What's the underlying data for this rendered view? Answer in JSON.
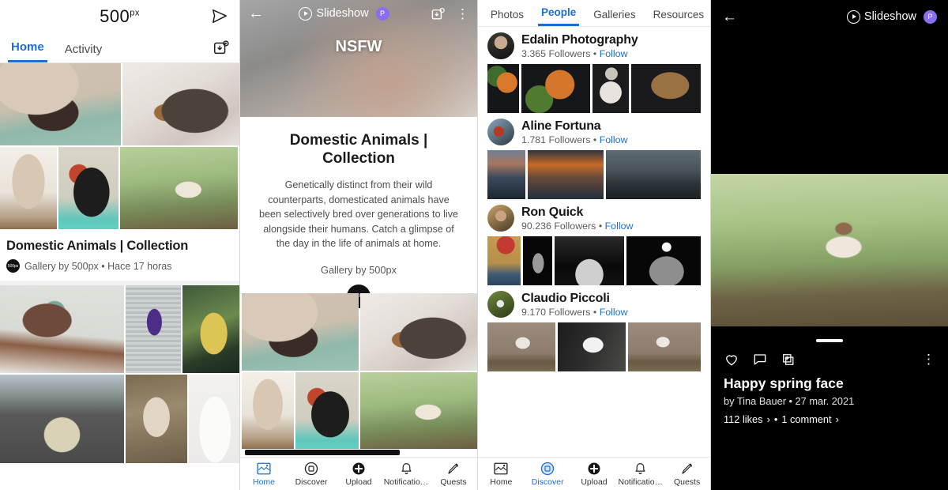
{
  "panel1": {
    "brand": "500",
    "brand_sup": "px",
    "icons": {
      "send": "send-icon",
      "save": "save-collection-icon"
    },
    "tabs": [
      {
        "label": "Home",
        "active": true
      },
      {
        "label": "Activity",
        "active": false
      }
    ],
    "card": {
      "title": "Domestic Animals | Collection",
      "byline": "Gallery by 500px • Hace 17 horas",
      "avatar_text": "500px"
    },
    "grid_top": [
      {
        "name": "cat-on-shoulder"
      },
      {
        "name": "dogs-on-bed"
      },
      {
        "name": "borzoi-dog"
      },
      {
        "name": "black-schnauzer"
      },
      {
        "name": "running-dog-forest"
      }
    ],
    "grid_bottom": [
      {
        "name": "woman-at-table"
      },
      {
        "name": "man-purple-jacket"
      },
      {
        "name": "woman-yellow-leaves"
      },
      {
        "name": "tent-on-road"
      },
      {
        "name": "portrait-woman-branches"
      },
      {
        "name": "white-pomeranian"
      }
    ]
  },
  "panel2": {
    "back": "←",
    "slideshow_label": "Slideshow",
    "badge": "P",
    "hero_title": "NSFW",
    "title": "Domestic Animals | Collection",
    "description": "Genetically distinct from their wild counterparts, domesticated animals have been selectively bred over generations to live alongside their humans. Catch a glimpse of the day in the life of animals at home.",
    "gallery_by": "Gallery by 500px",
    "logo_text": "500px",
    "nav": [
      {
        "label": "Home",
        "icon": "home-icon",
        "active": true
      },
      {
        "label": "Discover",
        "icon": "discover-icon",
        "active": false
      },
      {
        "label": "Upload",
        "icon": "upload-icon",
        "active": false
      },
      {
        "label": "Notificatio…",
        "icon": "bell-icon",
        "active": false
      },
      {
        "label": "Quests",
        "icon": "quests-icon",
        "active": false
      }
    ]
  },
  "panel3": {
    "tabs": [
      {
        "label": "Photos",
        "active": false
      },
      {
        "label": "People",
        "active": true
      },
      {
        "label": "Galleries",
        "active": false
      },
      {
        "label": "Resources",
        "active": false
      }
    ],
    "users": [
      {
        "name": "Edalin Photography",
        "followers": "3.365 Followers",
        "dot": "•",
        "follow": "Follow",
        "thumbs": [
          "soup-bowls-dark",
          "pumpkin-soup",
          "berry-bowl",
          "walnut-crate"
        ]
      },
      {
        "name": "Aline Fortuna",
        "followers": "1.781 Followers",
        "dot": "•",
        "follow": "Follow",
        "thumbs": [
          "coastal-dusk",
          "sunset-mountain",
          "moody-mountain"
        ]
      },
      {
        "name": "Ron Quick",
        "followers": "90.236 Followers",
        "dot": "•",
        "follow": "Follow",
        "thumbs": [
          "red-lamp-interior",
          "bw-vase",
          "bw-stage-piano",
          "bw-streetlamp"
        ]
      },
      {
        "name": "Claudio Piccoli",
        "followers": "9.170 Followers",
        "dot": "•",
        "follow": "Follow",
        "thumbs": [
          "border-collie-1",
          "border-collie-bw",
          "border-collie-2"
        ]
      }
    ],
    "nav": [
      {
        "label": "Home",
        "icon": "home-icon",
        "active": false
      },
      {
        "label": "Discover",
        "icon": "discover-icon",
        "active": true
      },
      {
        "label": "Upload",
        "icon": "upload-icon",
        "active": false
      },
      {
        "label": "Notificatio…",
        "icon": "bell-icon",
        "active": false
      },
      {
        "label": "Quests",
        "icon": "quests-icon",
        "active": false
      }
    ]
  },
  "panel4": {
    "back": "←",
    "slideshow_label": "Slideshow",
    "badge": "P",
    "photo": "running-dog-forest",
    "title": "Happy spring face",
    "byline": "by Tina Bauer  •  27 mar. 2021",
    "likes": "112 likes",
    "chev1": "›",
    "dot": "•",
    "comments": "1 comment",
    "chev2": "›",
    "kebab": "⋮",
    "actions": [
      "heart-icon",
      "comment-icon",
      "add-to-gallery-icon"
    ]
  },
  "colors": {
    "accent": "#1a6fd4",
    "pro_badge": "#8a6ef0",
    "dark_bg": "#000000",
    "text": "#1c1c1c"
  }
}
